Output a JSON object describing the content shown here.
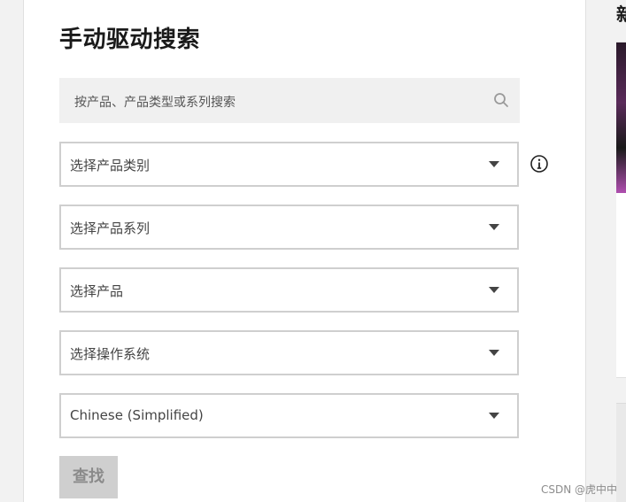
{
  "page": {
    "title": "手动驱动搜索",
    "search": {
      "placeholder": "按产品、产品类型或系列搜索"
    },
    "selects": [
      {
        "label": "选择产品类别"
      },
      {
        "label": "选择产品系列"
      },
      {
        "label": "选择产品"
      },
      {
        "label": "选择操作系统"
      },
      {
        "label": "Chinese (Simplified)"
      }
    ],
    "find_button": "查找",
    "right_heading": "新"
  },
  "watermark": "CSDN @虎中中",
  "colors": {
    "card_bg": "#ffffff",
    "page_bg": "#f2f2f2",
    "search_bg": "#f0f0f0",
    "border": "#cfcfcf",
    "button_disabled_bg": "#cfcfcf",
    "button_disabled_text": "#8a8a8a"
  },
  "icons": {
    "search": "search-icon",
    "info": "info-icon",
    "dropdown": "chevron-down-icon"
  }
}
